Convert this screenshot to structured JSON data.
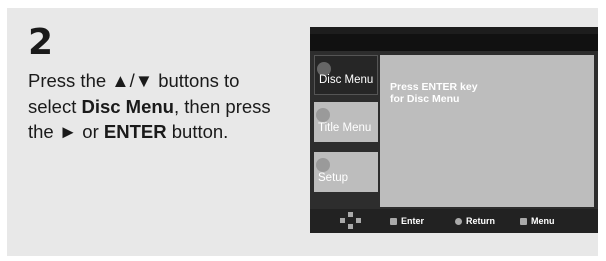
{
  "step": {
    "number": "2"
  },
  "instruction": {
    "t1": "Press the ",
    "arrows": "▲/▼",
    "t2": " buttons to select ",
    "disc_menu_bold": "Disc Menu",
    "t3": ", then press the ",
    "right_arrow": "►",
    "t4": " or ",
    "enter_bold": "ENTER",
    "t5": " button."
  },
  "screen": {
    "menu": {
      "disc_menu": "Disc Menu",
      "title_menu": "Title Menu",
      "setup": "Setup"
    },
    "message": {
      "line1": "Press ENTER key",
      "line2": "for Disc Menu"
    },
    "bottom": {
      "enter": "Enter",
      "return": "Return",
      "menu": "Menu"
    }
  },
  "colors": {
    "panel_bg": "#e8e8e8",
    "screen_bg": "#2d2d2d",
    "menu_gray": "#bdbdbd",
    "selected_tab": "#262626"
  }
}
